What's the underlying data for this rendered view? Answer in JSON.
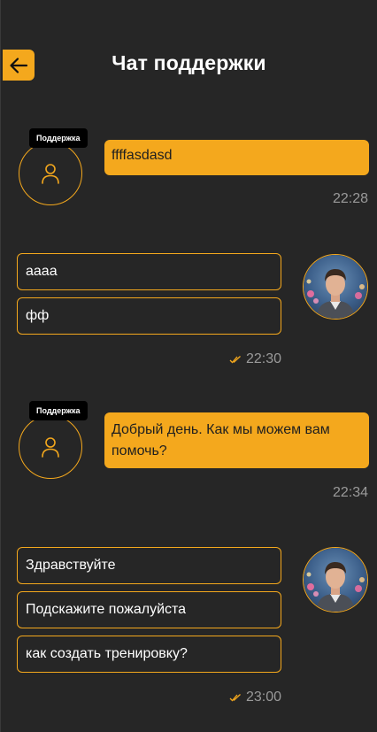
{
  "header": {
    "title": "Чат поддержки"
  },
  "support": {
    "badge": "Поддержка"
  },
  "messages": [
    {
      "sender": "support",
      "texts": [
        "ffffasdasd"
      ],
      "time": "22:28"
    },
    {
      "sender": "user",
      "texts": [
        "аааа",
        "фф"
      ],
      "time": "22:30",
      "read": true
    },
    {
      "sender": "support",
      "texts": [
        "Добрый день. Как мы можем вам помочь?"
      ],
      "time": "22:34"
    },
    {
      "sender": "user",
      "texts": [
        "Здравствуйте",
        "Подскажите пожалуйста",
        "как создать тренировку?"
      ],
      "time": "23:00",
      "read": true
    }
  ],
  "colors": {
    "background": "#262626",
    "accent": "#f4a81d",
    "timestamp": "#9a9a9a"
  },
  "icons": {
    "back": "arrow-left-icon",
    "support_avatar": "user-outline-icon",
    "read_status": "double-check-icon"
  }
}
